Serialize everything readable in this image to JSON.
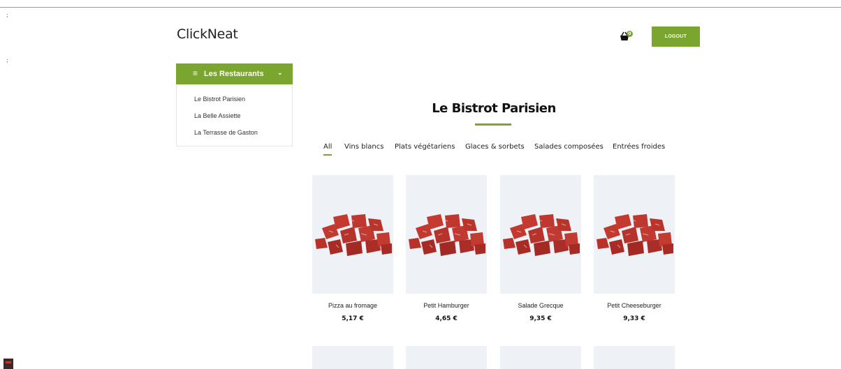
{
  "header": {
    "logo": "ClickNeat",
    "cart_count": "0",
    "logout_label": "LOGOUT"
  },
  "sidebar": {
    "heading": "Les Restaurants",
    "items": [
      {
        "label": "Le Bistrot Parisien"
      },
      {
        "label": "La Belle Assiette"
      },
      {
        "label": "La Terrasse de Gaston"
      }
    ]
  },
  "main": {
    "title": "Le Bistrot Parisien",
    "tabs": [
      {
        "label": "All",
        "active": true
      },
      {
        "label": "Vins blancs"
      },
      {
        "label": "Plats végétariens"
      },
      {
        "label": "Glaces & sorbets"
      },
      {
        "label": "Salades composées"
      },
      {
        "label": "Entrées froides"
      }
    ],
    "products": [
      {
        "name": "Pizza au fromage",
        "price": "5,17 €"
      },
      {
        "name": "Petit Hamburger",
        "price": "4,65 €"
      },
      {
        "name": "Salade Grecque",
        "price": "9,35 €"
      },
      {
        "name": "Petit Cheeseburger",
        "price": "9,33 €"
      }
    ]
  },
  "colors": {
    "accent": "#7aa52f",
    "card_bg": "#eef2f7",
    "meat": "#b8322a"
  }
}
